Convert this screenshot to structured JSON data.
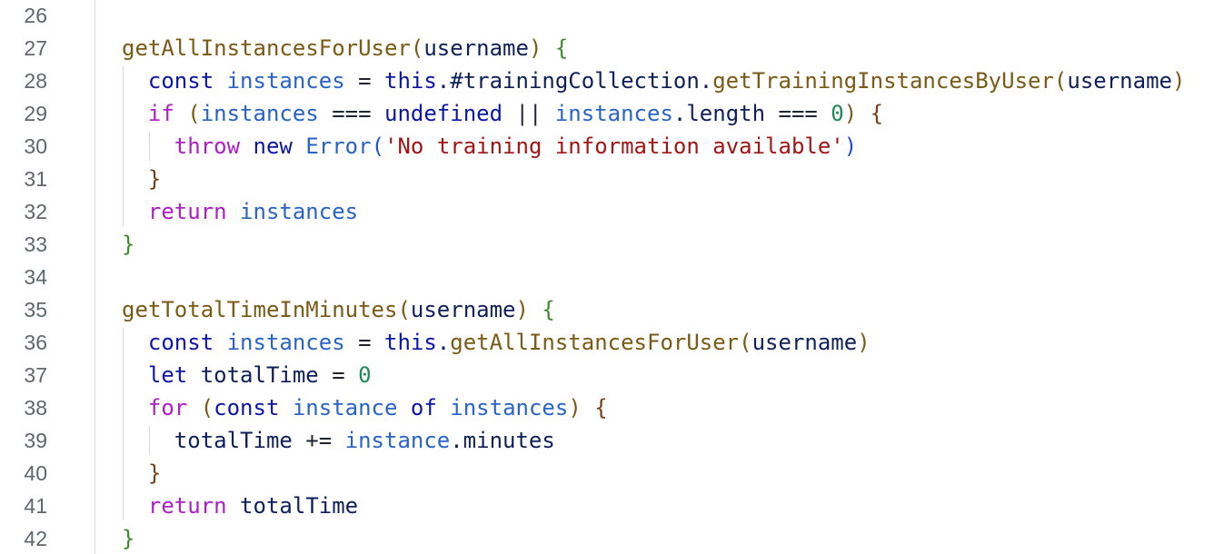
{
  "editor": {
    "lines": [
      {
        "num": "26",
        "tokens": []
      },
      {
        "num": "27",
        "tokens": [
          {
            "t": "getAllInstancesForUser",
            "c": "fn"
          },
          {
            "t": "(",
            "c": "paren-brown"
          },
          {
            "t": "username",
            "c": "ident"
          },
          {
            "t": ")",
            "c": "paren-brown"
          },
          {
            "t": " ",
            "c": "plain"
          },
          {
            "t": "{",
            "c": "brace-green"
          }
        ]
      },
      {
        "num": "28",
        "tokens": [
          {
            "t": "const",
            "c": "kw-blue"
          },
          {
            "t": " ",
            "c": "plain"
          },
          {
            "t": "instances",
            "c": "var"
          },
          {
            "t": " = ",
            "c": "plain"
          },
          {
            "t": "this",
            "c": "kw-blue"
          },
          {
            "t": ".#trainingCollection.",
            "c": "ident"
          },
          {
            "t": "getTrainingInstancesByUser",
            "c": "fn"
          },
          {
            "t": "(",
            "c": "paren-brown"
          },
          {
            "t": "username",
            "c": "ident"
          },
          {
            "t": ")",
            "c": "paren-brown"
          }
        ]
      },
      {
        "num": "29",
        "tokens": [
          {
            "t": "if",
            "c": "kw-purple"
          },
          {
            "t": " ",
            "c": "plain"
          },
          {
            "t": "(",
            "c": "paren-brown"
          },
          {
            "t": "instances",
            "c": "var"
          },
          {
            "t": " === ",
            "c": "plain"
          },
          {
            "t": "undefined",
            "c": "kw-blue"
          },
          {
            "t": " || ",
            "c": "plain"
          },
          {
            "t": "instances",
            "c": "var"
          },
          {
            "t": ".length",
            "c": "ident"
          },
          {
            "t": " === ",
            "c": "plain"
          },
          {
            "t": "0",
            "c": "num"
          },
          {
            "t": ")",
            "c": "paren-brown"
          },
          {
            "t": " ",
            "c": "plain"
          },
          {
            "t": "{",
            "c": "brace-brown"
          }
        ]
      },
      {
        "num": "30",
        "tokens": [
          {
            "t": "throw",
            "c": "kw-purple"
          },
          {
            "t": " ",
            "c": "plain"
          },
          {
            "t": "new",
            "c": "kw-blue"
          },
          {
            "t": " ",
            "c": "plain"
          },
          {
            "t": "Error",
            "c": "var"
          },
          {
            "t": "(",
            "c": "paren-blue"
          },
          {
            "t": "'No training information available'",
            "c": "str"
          },
          {
            "t": ")",
            "c": "paren-blue"
          }
        ]
      },
      {
        "num": "31",
        "tokens": [
          {
            "t": "}",
            "c": "brace-brown"
          }
        ]
      },
      {
        "num": "32",
        "tokens": [
          {
            "t": "return",
            "c": "kw-purple"
          },
          {
            "t": " ",
            "c": "plain"
          },
          {
            "t": "instances",
            "c": "var"
          }
        ]
      },
      {
        "num": "33",
        "tokens": [
          {
            "t": "}",
            "c": "brace-green"
          }
        ]
      },
      {
        "num": "34",
        "tokens": []
      },
      {
        "num": "35",
        "tokens": [
          {
            "t": "getTotalTimeInMinutes",
            "c": "fn"
          },
          {
            "t": "(",
            "c": "paren-brown"
          },
          {
            "t": "username",
            "c": "ident"
          },
          {
            "t": ")",
            "c": "paren-brown"
          },
          {
            "t": " ",
            "c": "plain"
          },
          {
            "t": "{",
            "c": "brace-green"
          }
        ]
      },
      {
        "num": "36",
        "tokens": [
          {
            "t": "const",
            "c": "kw-blue"
          },
          {
            "t": " ",
            "c": "plain"
          },
          {
            "t": "instances",
            "c": "var"
          },
          {
            "t": " = ",
            "c": "plain"
          },
          {
            "t": "this",
            "c": "kw-blue"
          },
          {
            "t": ".",
            "c": "ident"
          },
          {
            "t": "getAllInstancesForUser",
            "c": "fn"
          },
          {
            "t": "(",
            "c": "paren-brown"
          },
          {
            "t": "username",
            "c": "ident"
          },
          {
            "t": ")",
            "c": "paren-brown"
          }
        ]
      },
      {
        "num": "37",
        "tokens": [
          {
            "t": "let",
            "c": "kw-blue"
          },
          {
            "t": " ",
            "c": "plain"
          },
          {
            "t": "totalTime",
            "c": "ident"
          },
          {
            "t": " = ",
            "c": "plain"
          },
          {
            "t": "0",
            "c": "num"
          }
        ]
      },
      {
        "num": "38",
        "tokens": [
          {
            "t": "for",
            "c": "kw-purple"
          },
          {
            "t": " ",
            "c": "plain"
          },
          {
            "t": "(",
            "c": "paren-brown"
          },
          {
            "t": "const",
            "c": "kw-blue"
          },
          {
            "t": " ",
            "c": "plain"
          },
          {
            "t": "instance",
            "c": "var"
          },
          {
            "t": " ",
            "c": "plain"
          },
          {
            "t": "of",
            "c": "kw-blue"
          },
          {
            "t": " ",
            "c": "plain"
          },
          {
            "t": "instances",
            "c": "var"
          },
          {
            "t": ")",
            "c": "paren-brown"
          },
          {
            "t": " ",
            "c": "plain"
          },
          {
            "t": "{",
            "c": "brace-brown"
          }
        ]
      },
      {
        "num": "39",
        "tokens": [
          {
            "t": "totalTime",
            "c": "ident"
          },
          {
            "t": " += ",
            "c": "plain"
          },
          {
            "t": "instance",
            "c": "var"
          },
          {
            "t": ".minutes",
            "c": "ident"
          }
        ]
      },
      {
        "num": "40",
        "tokens": [
          {
            "t": "}",
            "c": "brace-brown"
          }
        ]
      },
      {
        "num": "41",
        "tokens": [
          {
            "t": "return",
            "c": "kw-purple"
          },
          {
            "t": " ",
            "c": "plain"
          },
          {
            "t": "totalTime",
            "c": "ident"
          }
        ]
      },
      {
        "num": "42",
        "tokens": [
          {
            "t": "}",
            "c": "brace-green"
          }
        ]
      }
    ]
  }
}
